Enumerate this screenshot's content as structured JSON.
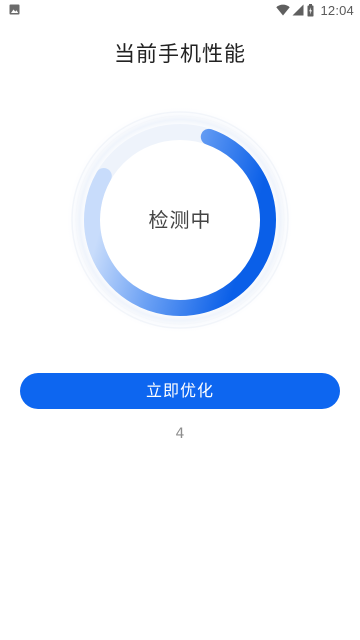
{
  "status_bar": {
    "time": "12:04",
    "icons": [
      "image-icon",
      "wifi-icon",
      "signal-icon",
      "battery-icon"
    ]
  },
  "header": {
    "title": "当前手机性能"
  },
  "gauge": {
    "status_text": "检测中",
    "progress": 0.78,
    "colors": {
      "start": "#0a5fe8",
      "end": "#c8dcfb",
      "track": "#eef3fb"
    }
  },
  "actions": {
    "optimize_label": "立即优化"
  },
  "counter": {
    "value": "4"
  },
  "theme": {
    "accent": "#0d66f0"
  }
}
